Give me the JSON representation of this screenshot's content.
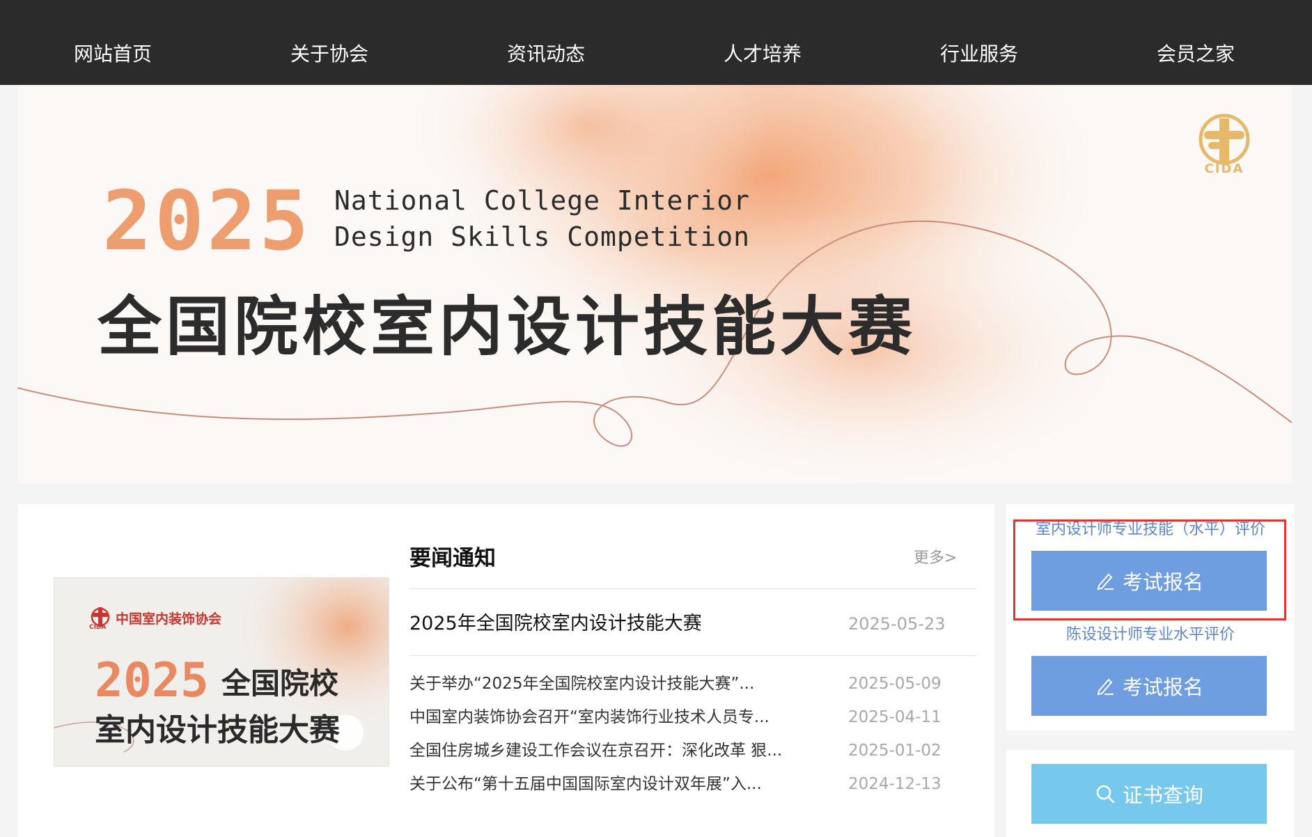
{
  "nav": {
    "items": [
      "网站首页",
      "关于协会",
      "资讯动态",
      "人才培养",
      "行业服务",
      "会员之家"
    ]
  },
  "banner": {
    "year": "2025",
    "title_en_line1": "National College Interior",
    "title_en_line2": "Design Skills Competition",
    "title_cn": "全国院校室内设计技能大赛",
    "logo_text": "CIDA",
    "logo_icon": "cida-logo-icon"
  },
  "news": {
    "title": "要闻通知",
    "more_label": "更多>",
    "thumbnail": {
      "org_name": "中国室内装饰协会",
      "logo_text": "CIDA",
      "year": "2025",
      "title_line1": "全国院校",
      "title_line2": "室内设计技能大赛"
    },
    "headline": {
      "title": "2025年全国院校室内设计技能大赛",
      "date": "2025-05-23"
    },
    "items": [
      {
        "title": "关于举办“2025年全国院校室内设计技能大赛”...",
        "date": "2025-05-09"
      },
      {
        "title": "中国室内装饰协会召开“室内装饰行业技术人员专...",
        "date": "2025-04-11"
      },
      {
        "title": "全国住房城乡建设工作会议在京召开：深化改革 狠...",
        "date": "2025-01-02"
      },
      {
        "title": "关于公布“第十五届中国国际室内设计双年展”入...",
        "date": "2024-12-13"
      }
    ]
  },
  "sidebar": {
    "section1_label": "室内设计师专业技能（水平）评价",
    "section1_button": "考试报名",
    "section2_label": "陈设设计师专业水平评价",
    "section2_button": "考试报名",
    "cert_button": "证书查询",
    "colors": {
      "button_blue": "#6f9ee0",
      "button_cyan": "#76c9ec",
      "highlight_red": "#e0322f"
    }
  }
}
